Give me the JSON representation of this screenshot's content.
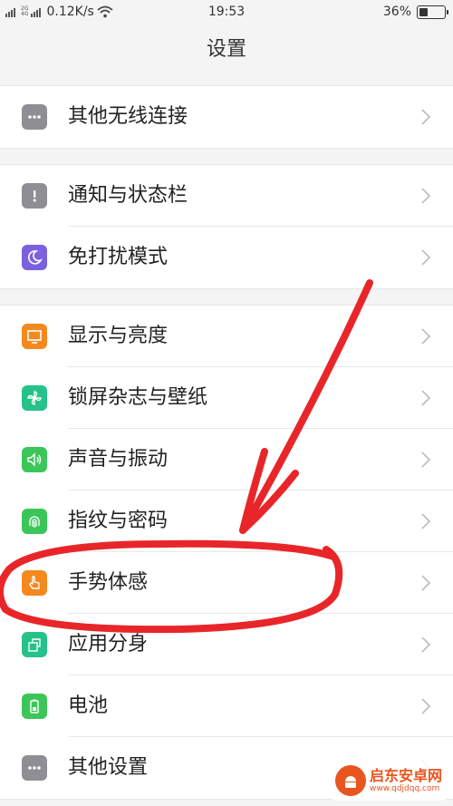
{
  "status_bar": {
    "network_top": "2G",
    "network_bottom": "4G",
    "speed": "0.12K/s",
    "time": "19:53",
    "battery_percent_text": "36%",
    "battery_level": 0.36
  },
  "header": {
    "title": "设置"
  },
  "groups": [
    {
      "items": [
        {
          "label": "其他无线连接",
          "icon": "more-dots-icon",
          "icon_color": "#8e8e93"
        }
      ]
    },
    {
      "items": [
        {
          "label": "通知与状态栏",
          "icon": "exclamation-icon",
          "icon_color": "#8e8e93"
        },
        {
          "label": "免打扰模式",
          "icon": "moon-icon",
          "icon_color": "#7b61e0"
        }
      ]
    },
    {
      "items": [
        {
          "label": "显示与亮度",
          "icon": "display-icon",
          "icon_color": "#f5891e"
        },
        {
          "label": "锁屏杂志与壁纸",
          "icon": "pinwheel-icon",
          "icon_color": "#25c28a"
        },
        {
          "label": "声音与振动",
          "icon": "speaker-icon",
          "icon_color": "#3cc65a"
        },
        {
          "label": "指纹与密码",
          "icon": "fingerprint-icon",
          "icon_color": "#3cc65a"
        },
        {
          "label": "手势体感",
          "icon": "hand-gesture-icon",
          "icon_color": "#f5891e"
        },
        {
          "label": "应用分身",
          "icon": "app-clone-icon",
          "icon_color": "#25c28a"
        },
        {
          "label": "电池",
          "icon": "battery-icon",
          "icon_color": "#3cc65a"
        },
        {
          "label": "其他设置",
          "icon": "more-dots-icon",
          "icon_color": "#8e8e93"
        }
      ]
    }
  ],
  "annotation": {
    "color": "#e8262a"
  },
  "watermark": {
    "title": "启东安卓网",
    "url": "www.qdjdqq.com"
  }
}
